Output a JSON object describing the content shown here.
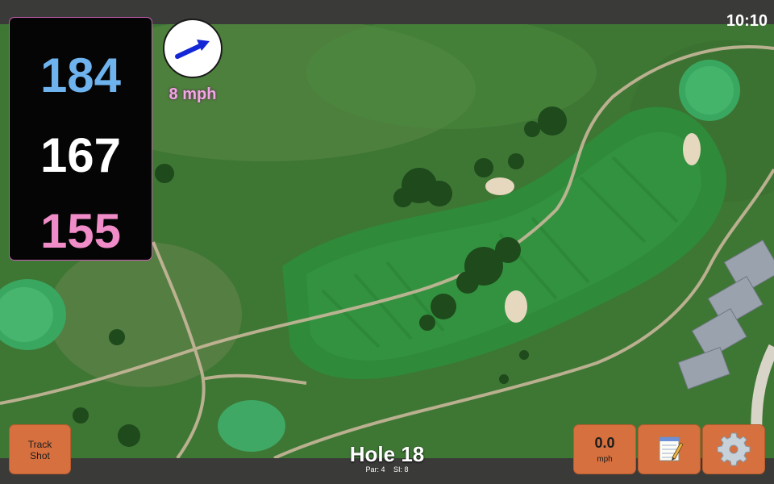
{
  "status": {
    "time": "10:10"
  },
  "yardage": {
    "back": "184",
    "middle": "167",
    "front": "155"
  },
  "wind": {
    "speed_text": "8 mph",
    "arrow_icon": "wind-arrow-icon"
  },
  "hole": {
    "title": "Hole 18",
    "par": "Par: 4",
    "si": "SI: 8"
  },
  "buttons": {
    "track_line1": "Track",
    "track_line2": "Shot",
    "speed_value": "0.0",
    "speed_unit": "mph",
    "notes_icon": "notepad-icon",
    "settings_icon": "gear-icon"
  },
  "colors": {
    "back": "#6eb3ee",
    "middle": "#ffffff",
    "front": "#f08cc8",
    "button": "#d6703e",
    "wind_text": "#f3a6e6",
    "wind_arrow": "#1427d6"
  }
}
